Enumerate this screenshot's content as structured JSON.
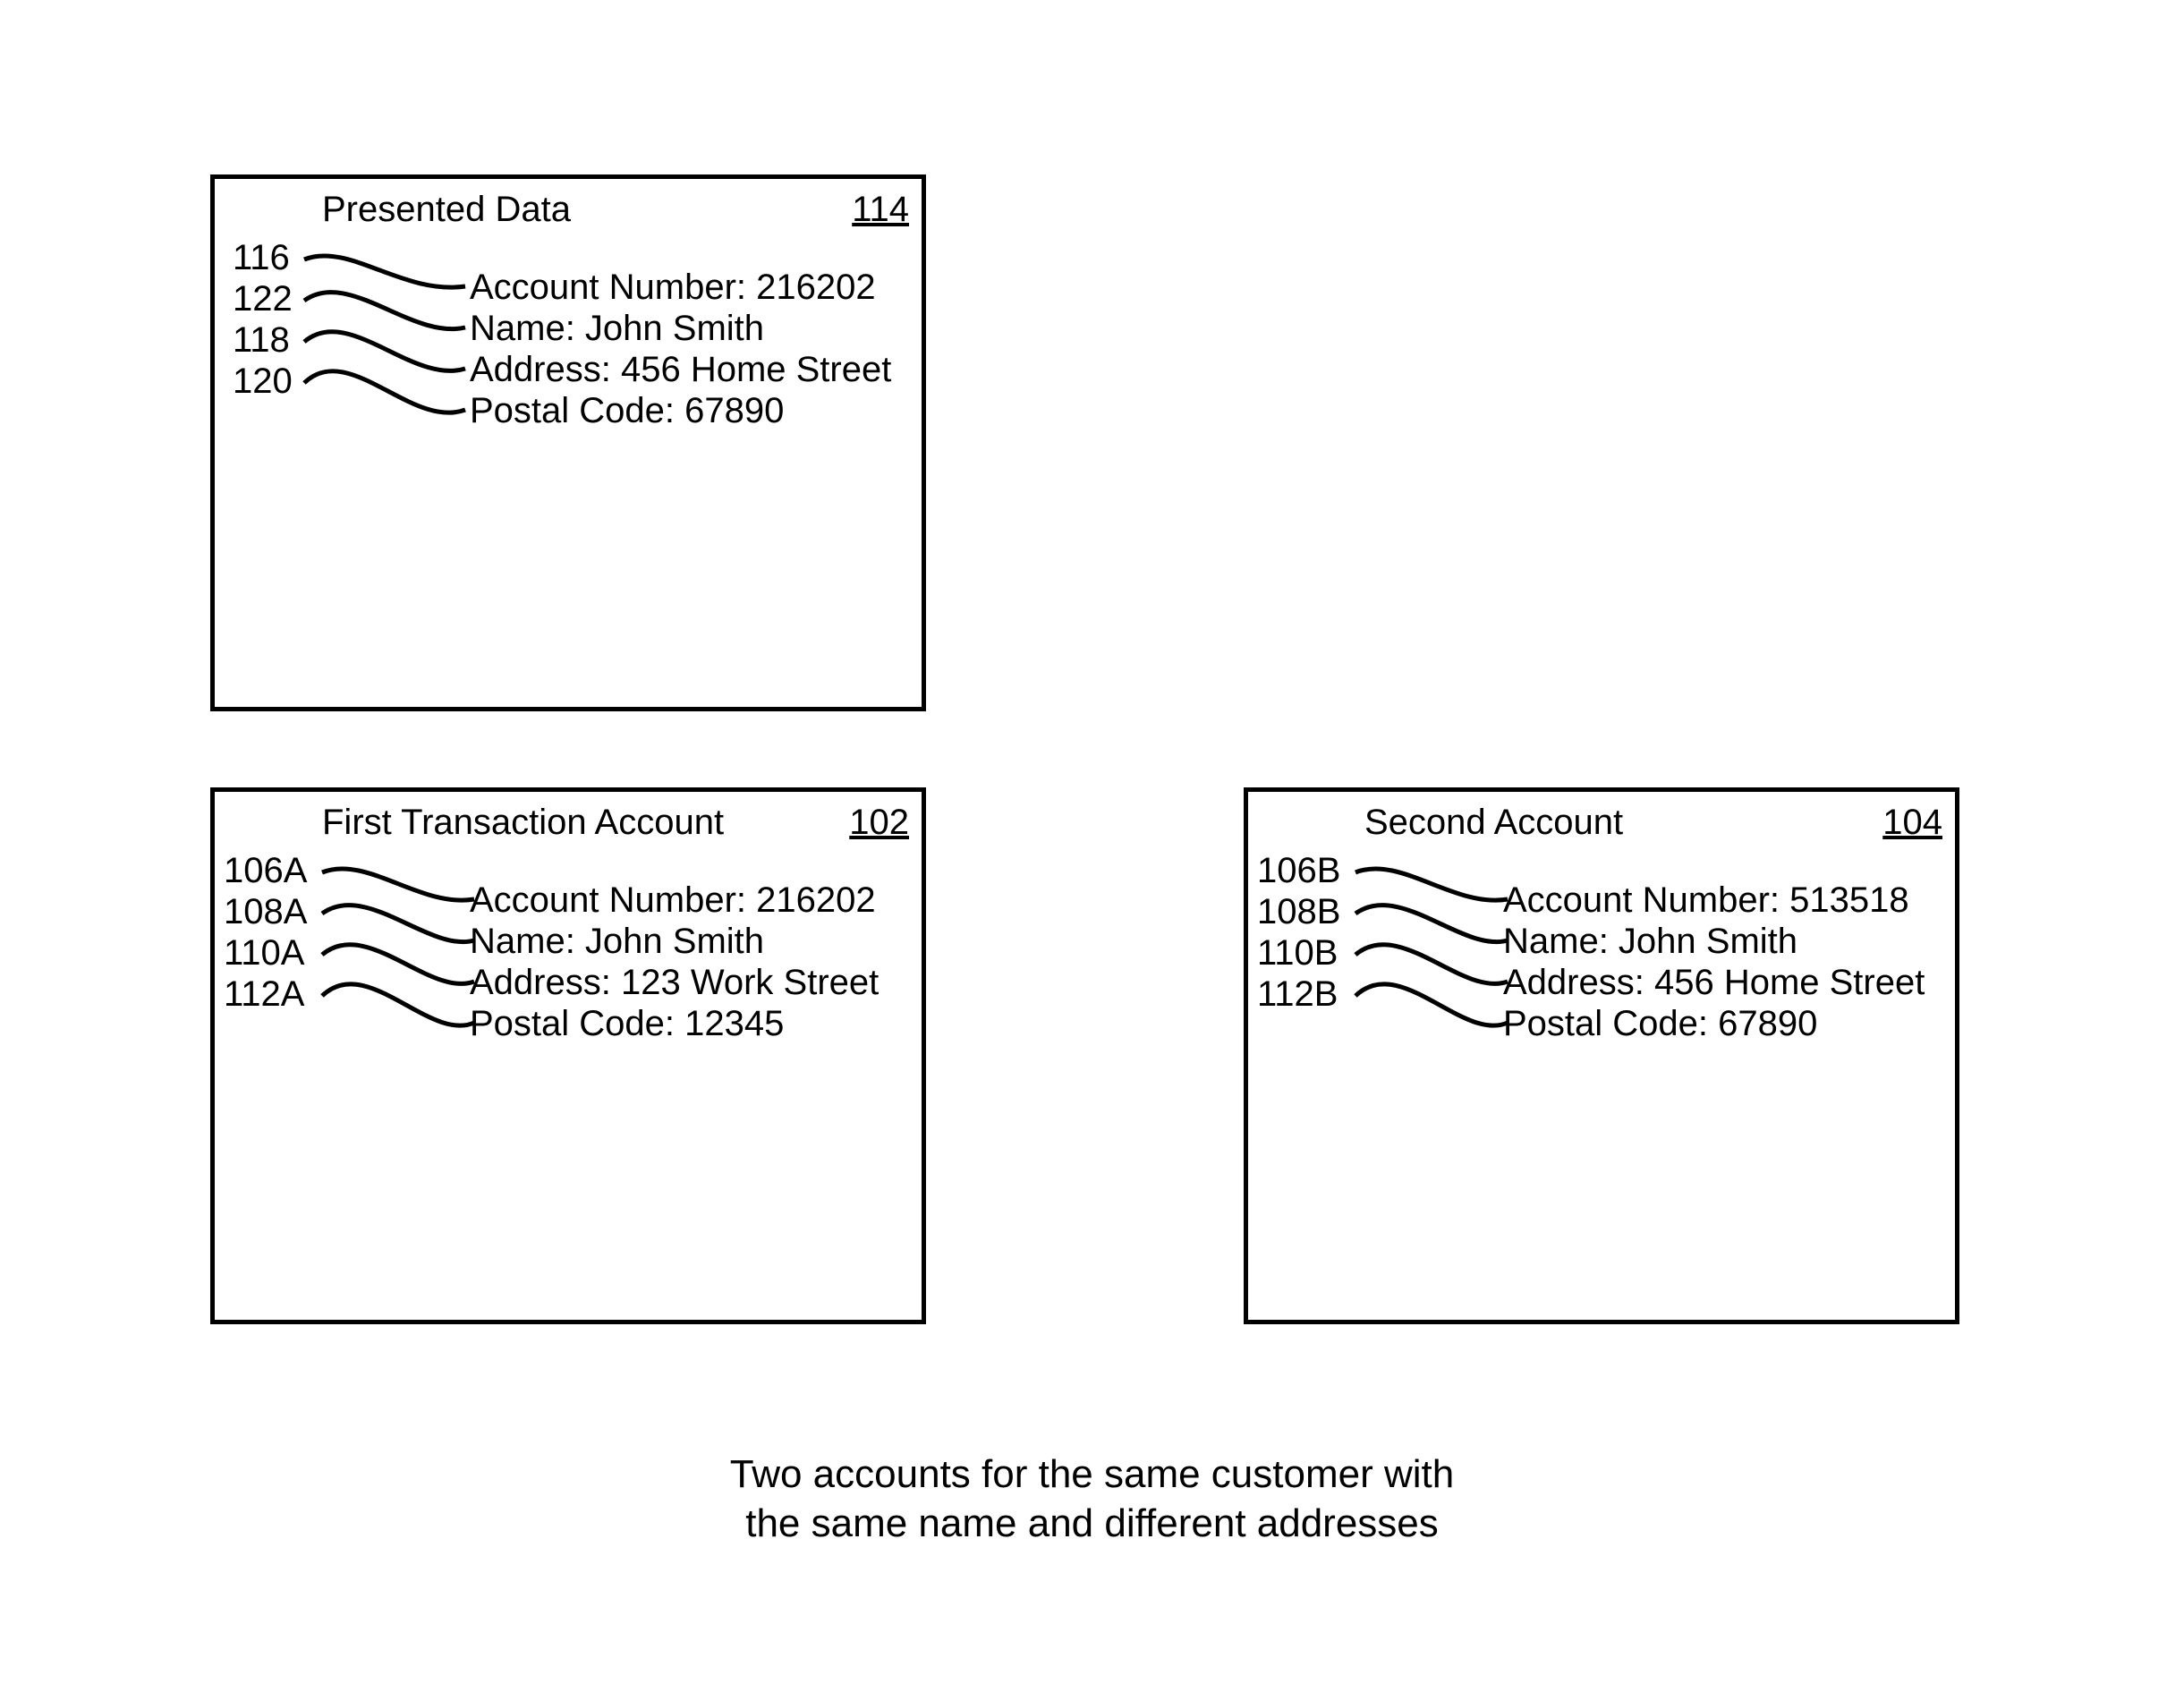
{
  "boxes": {
    "presented": {
      "title": "Presented Data",
      "ref": "114",
      "fields": {
        "account": "Account Number:  216202",
        "name": "Name:  John Smith",
        "address": "Address:  456 Home Street",
        "postal": "Postal Code:  67890"
      },
      "labels": {
        "l1": "116",
        "l2": "122",
        "l3": "118",
        "l4": "120"
      }
    },
    "first": {
      "title": "First Transaction Account",
      "ref": "102",
      "fields": {
        "account": "Account Number:  216202",
        "name": "Name:  John Smith",
        "address": "Address:  123 Work Street",
        "postal": "Postal Code:  12345"
      },
      "labels": {
        "l1": "106A",
        "l2": "108A",
        "l3": "110A",
        "l4": "112A"
      }
    },
    "second": {
      "title": "Second Account",
      "ref": "104",
      "fields": {
        "account": "Account Number:  513518",
        "name": "Name:  John Smith",
        "address": "Address:  456 Home Street",
        "postal": "Postal Code:  67890"
      },
      "labels": {
        "l1": "106B",
        "l2": "108B",
        "l3": "110B",
        "l4": "112B"
      }
    }
  },
  "caption": {
    "line1": "Two accounts for the same customer with",
    "line2": "the same name and different addresses"
  }
}
